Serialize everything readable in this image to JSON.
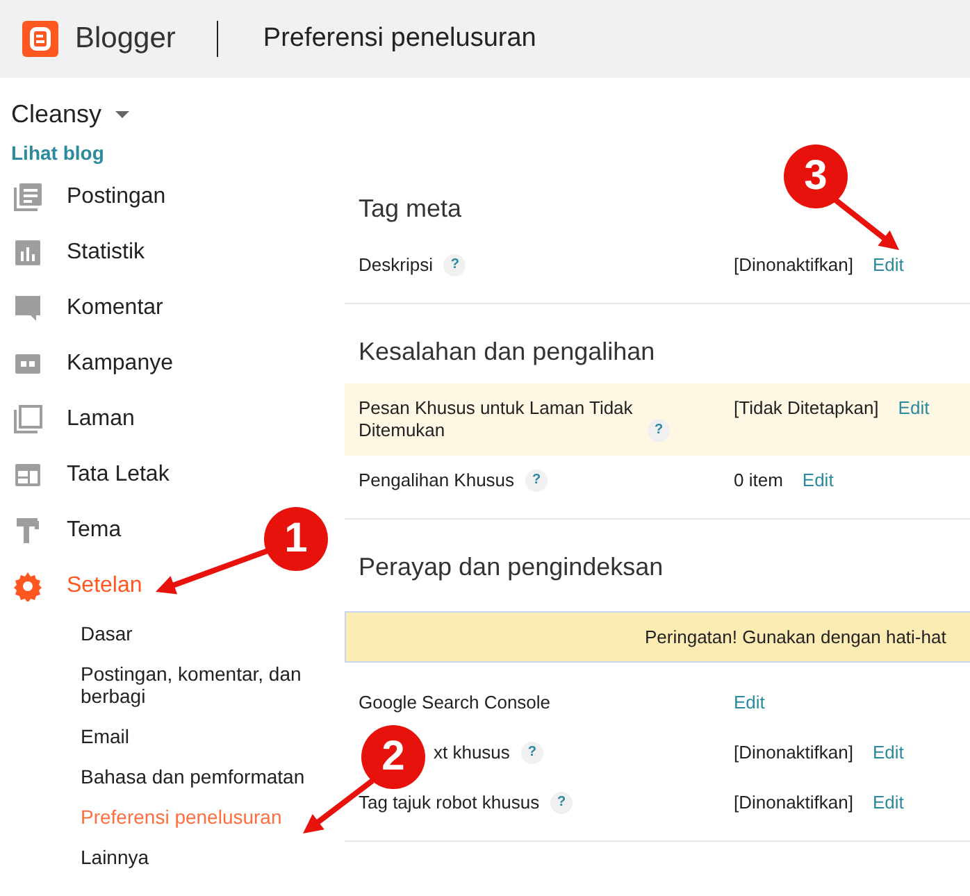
{
  "header": {
    "brand": "Blogger",
    "title": "Preferensi penelusuran"
  },
  "sidebar": {
    "blog_name": "Cleansy",
    "view_blog": "Lihat blog",
    "items": [
      {
        "label": "Postingan",
        "selected": false
      },
      {
        "label": "Statistik",
        "selected": false
      },
      {
        "label": "Komentar",
        "selected": false
      },
      {
        "label": "Kampanye",
        "selected": false
      },
      {
        "label": "Laman",
        "selected": false
      },
      {
        "label": "Tata Letak",
        "selected": false
      },
      {
        "label": "Tema",
        "selected": false
      },
      {
        "label": "Setelan",
        "selected": true
      }
    ],
    "subitems": [
      {
        "label": "Dasar",
        "selected": false
      },
      {
        "label": "Postingan, komentar, dan berbagi",
        "selected": false
      },
      {
        "label": "Email",
        "selected": false
      },
      {
        "label": "Bahasa dan pemformatan",
        "selected": false
      },
      {
        "label": "Preferensi penelusuran",
        "selected": true
      },
      {
        "label": "Lainnya",
        "selected": false
      }
    ]
  },
  "sections": [
    {
      "title": "Tag meta",
      "rows": [
        {
          "label": "Deskripsi",
          "help": "?",
          "value": "[Dinonaktifkan]",
          "action": "Edit",
          "highlighted": false
        }
      ]
    },
    {
      "title": "Kesalahan dan pengalihan",
      "rows": [
        {
          "label": "Pesan Khusus untuk Laman Tidak Ditemukan",
          "help": "?",
          "value": "[Tidak Ditetapkan]",
          "action": "Edit",
          "highlighted": true
        },
        {
          "label": "Pengalihan Khusus",
          "help": "?",
          "value": "0 item",
          "action": "Edit",
          "highlighted": false
        }
      ]
    },
    {
      "title": "Perayap dan pengindeksan",
      "warning": "Peringatan! Gunakan dengan hati-hat",
      "rows": [
        {
          "label": "Google Search Console",
          "action": "Edit",
          "highlighted": false
        },
        {
          "label": "xt khusus",
          "help": "?",
          "value": "[Dinonaktifkan]",
          "action": "Edit",
          "highlighted": false
        },
        {
          "label": "Tag tajuk robot khusus",
          "help": "?",
          "value": "[Dinonaktifkan]",
          "action": "Edit",
          "highlighted": false
        }
      ]
    }
  ],
  "annotations": [
    {
      "number": "1"
    },
    {
      "number": "2"
    },
    {
      "number": "3"
    }
  ]
}
